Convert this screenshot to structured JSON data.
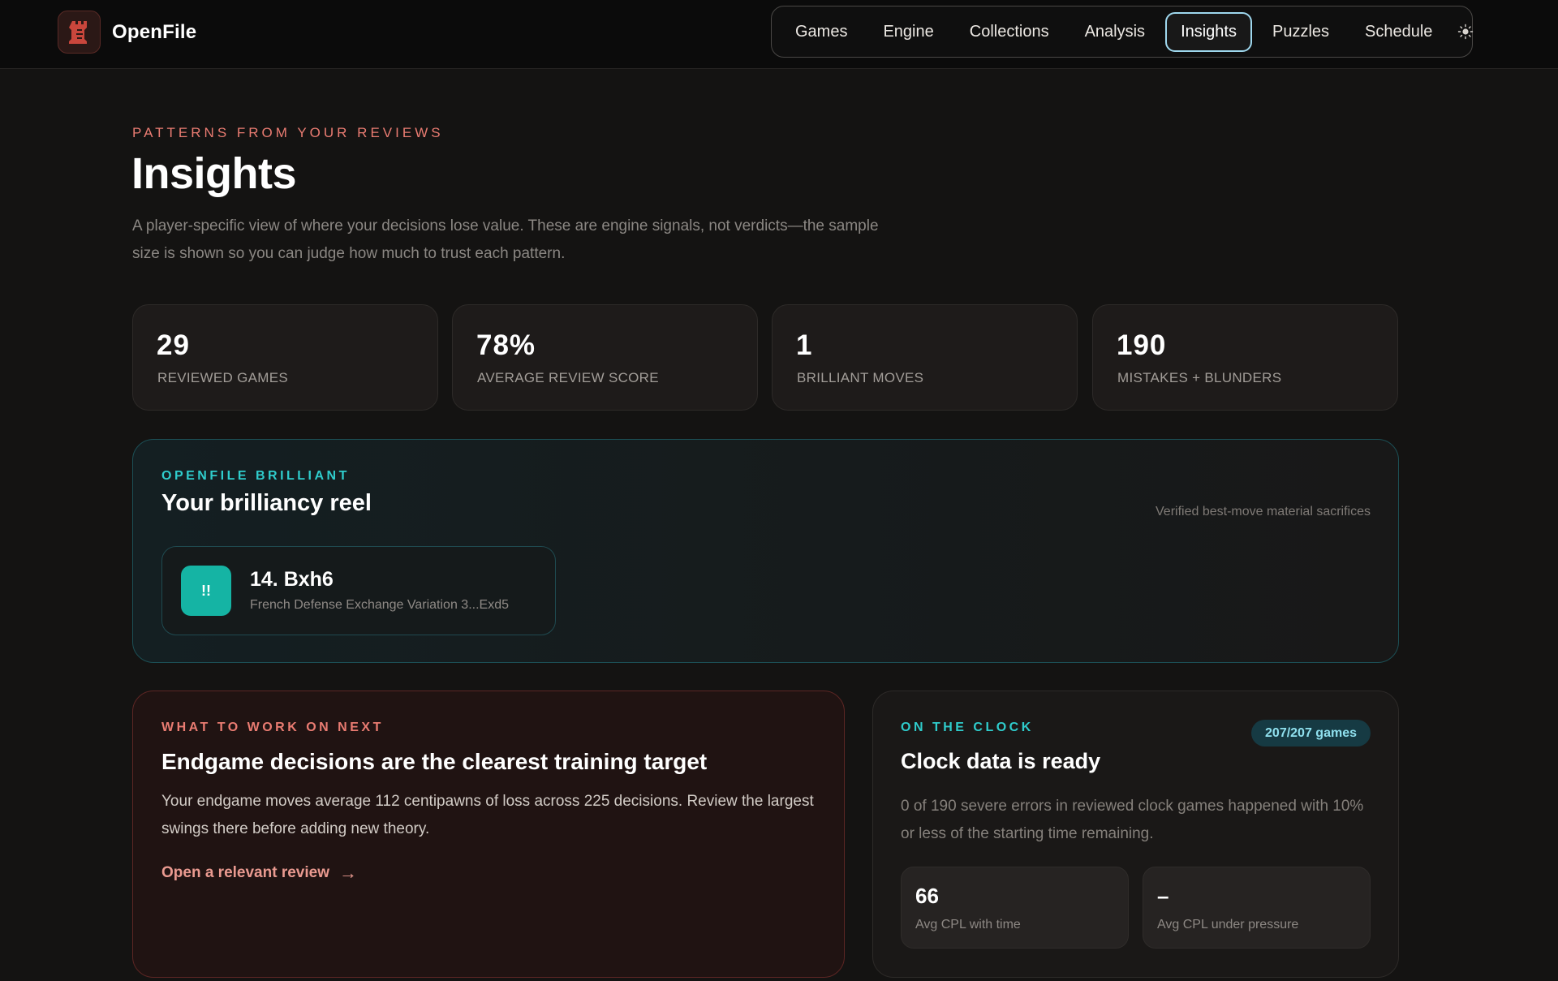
{
  "brand": {
    "name": "OpenFile",
    "logo_icon": "chess-rook-icon",
    "accent": "#e24b3f"
  },
  "nav": {
    "items": [
      {
        "label": "Games",
        "active": false
      },
      {
        "label": "Engine",
        "active": false
      },
      {
        "label": "Collections",
        "active": false
      },
      {
        "label": "Analysis",
        "active": false
      },
      {
        "label": "Insights",
        "active": true
      },
      {
        "label": "Puzzles",
        "active": false
      },
      {
        "label": "Schedule",
        "active": false
      }
    ],
    "theme_toggle_icon": "sun-icon"
  },
  "hero": {
    "eyebrow": "Patterns from your reviews",
    "title": "Insights",
    "subtitle": "A player-specific view of where your decisions lose value. These are engine signals, not verdicts—the sample size is shown so you can judge how much to trust each pattern."
  },
  "stats": [
    {
      "value": "29",
      "label": "Reviewed games"
    },
    {
      "value": "78%",
      "label": "Average review score"
    },
    {
      "value": "1",
      "label": "Brilliant moves"
    },
    {
      "value": "190",
      "label": "Mistakes + blunders"
    }
  ],
  "brilliant": {
    "eyebrow": "OpenFile Brilliant",
    "title": "Your brilliancy reel",
    "note": "Verified best-move material sacrifices",
    "moves": [
      {
        "badge": "!!",
        "move": "14. Bxh6",
        "description": "French Defense Exchange Variation 3...Exd5"
      }
    ],
    "accent": "#15b4a4"
  },
  "work_next": {
    "eyebrow": "What to work on next",
    "title": "Endgame decisions are the clearest training target",
    "body": "Your endgame moves average 112 centipawns of loss across 225 decisions. Review the largest swings there before adding new theory.",
    "link_label": "Open a relevant review",
    "link_icon": "arrow-right-icon"
  },
  "clock": {
    "eyebrow": "On the clock",
    "pill": "207/207 games",
    "title": "Clock data is ready",
    "body": "0 of 190 severe errors in reviewed clock games happened with 10% or less of the starting time remaining.",
    "metrics": [
      {
        "value": "66",
        "label": "Avg CPL with time"
      },
      {
        "value": "–",
        "label": "Avg CPL under pressure"
      }
    ]
  }
}
